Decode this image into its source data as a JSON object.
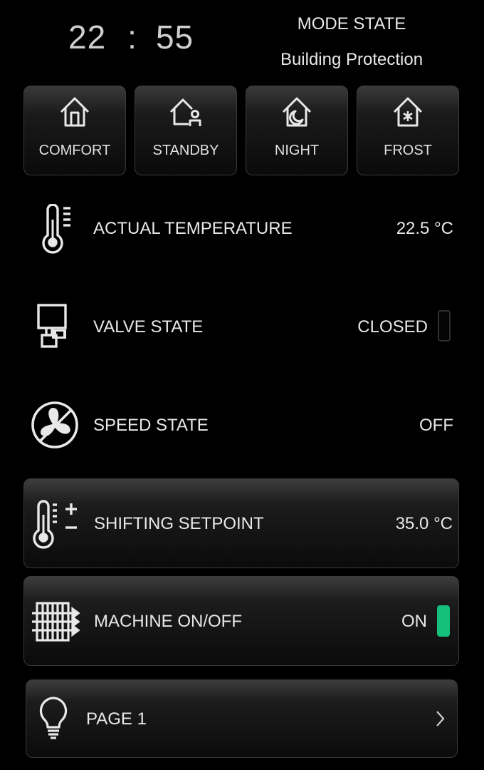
{
  "clock": {
    "hours": "22",
    "separator": ":",
    "minutes": "55"
  },
  "mode": {
    "title": "MODE STATE",
    "value": "Building Protection"
  },
  "mode_buttons": [
    {
      "label": "COMFORT",
      "icon": "home-icon"
    },
    {
      "label": "STANDBY",
      "icon": "home-person-icon"
    },
    {
      "label": "NIGHT",
      "icon": "home-moon-icon"
    },
    {
      "label": "FROST",
      "icon": "home-snowflake-icon"
    }
  ],
  "rows": {
    "actual_temperature": {
      "label": "ACTUAL TEMPERATURE",
      "value": "22.5 °C",
      "icon": "thermometer-icon"
    },
    "valve_state": {
      "label": "VALVE STATE",
      "value": "CLOSED",
      "icon": "valve-icon",
      "toggle_on": false
    },
    "speed_state": {
      "label": "SPEED STATE",
      "value": "OFF",
      "icon": "fan-icon"
    },
    "shifting_setpoint": {
      "label": "SHIFTING SETPOINT",
      "value": "35.0 °C",
      "icon": "thermometer-plus-minus-icon"
    },
    "machine": {
      "label": "MACHINE ON/OFF",
      "value": "ON",
      "icon": "heater-icon",
      "toggle_on": true
    },
    "page": {
      "label": "PAGE 1",
      "icon": "lightbulb-icon",
      "chevron_icon": "chevron-right-icon"
    }
  },
  "colors": {
    "background": "#000000",
    "text": "#e8e8e8",
    "toggle_on": "#14c07a",
    "toggle_off_border": "#2e2e2e"
  }
}
